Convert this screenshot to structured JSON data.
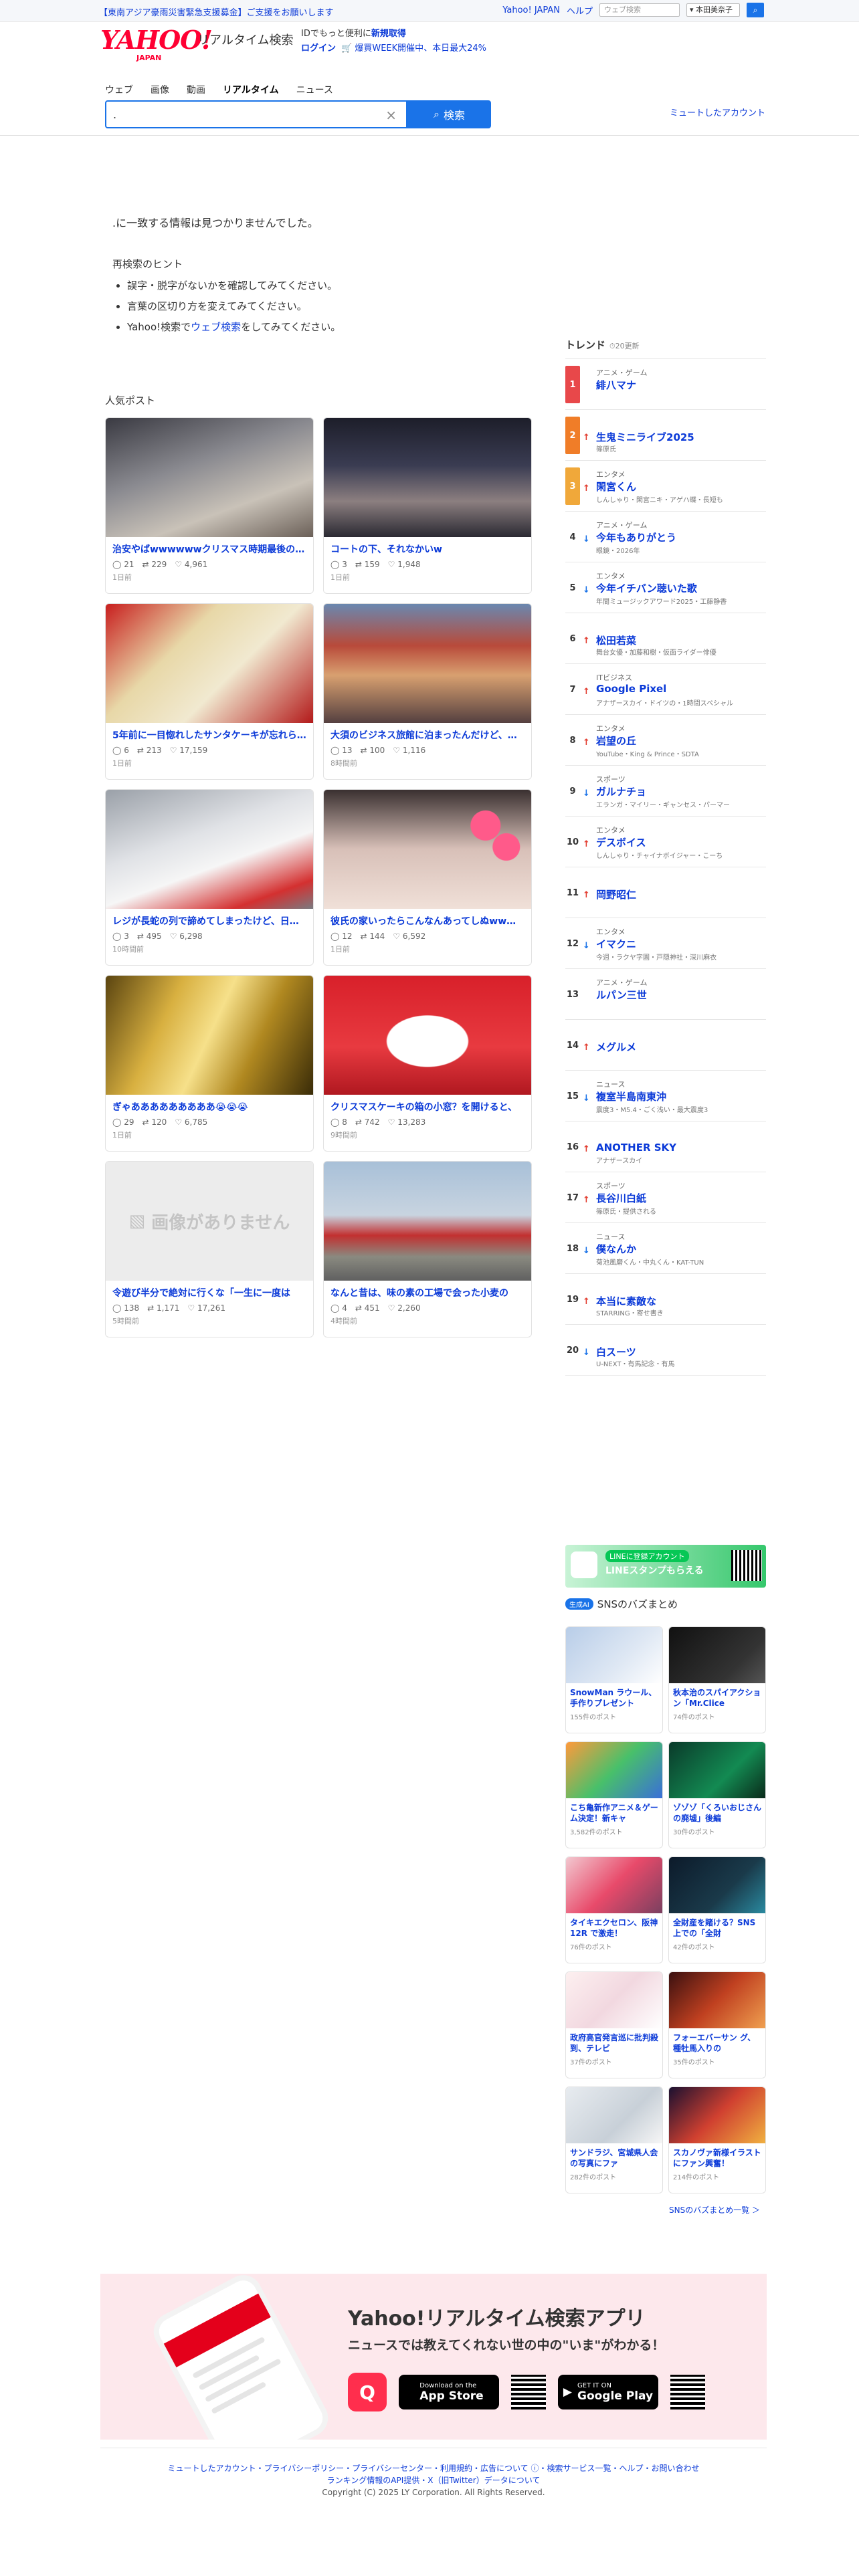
{
  "topbar": {
    "notice": "【東南アジア豪雨災害緊急支援募金】ご支援をお願いします",
    "links": [
      "Yahoo! JAPAN",
      "ヘルプ"
    ],
    "search_placeholder": "ウェブ検索",
    "search_scope": "▾ 本田美奈子"
  },
  "header": {
    "logo": "YAHOO!",
    "logo_sub": "JAPAN",
    "service": "リアルタイム検索",
    "promo_line1": "IDでもっと便利に",
    "promo_line1_link": "新規取得",
    "promo_login": "ログイン",
    "promo_offer": "🛒 爆買WEEK開催中、本日最大24%"
  },
  "tabs": [
    "ウェブ",
    "画像",
    "動画",
    "リアルタイム",
    "ニュース"
  ],
  "search": {
    "query": ".",
    "button": "検索",
    "muted_link": "ミュートしたアカウント"
  },
  "noresult": {
    "message": ".に一致する情報は見つかりませんでした。",
    "hint_title": "再検索のヒント",
    "hint1": "誤字・脱字がないかを確認してみてください。",
    "hint2": "言葉の区切り方を変えてみてください。",
    "hint3_pre": "Yahoo!検索で",
    "hint3_link": "ウェブ検索",
    "hint3_post": "をしてみてください。"
  },
  "popular": {
    "title": "人気ポスト",
    "posts": [
      {
        "caption": "治安やばwwwwwwクリスマス時期最後の土曜日",
        "replies": "21",
        "reposts": "229",
        "likes": "4,961",
        "time": "1日前"
      },
      {
        "caption": "コートの下、それなかいw",
        "replies": "3",
        "reposts": "159",
        "likes": "1,948",
        "time": "1日前"
      },
      {
        "caption": "5年前に一目惚れしたサンタケーキが忘れられない",
        "replies": "6",
        "reposts": "213",
        "likes": "17,159",
        "time": "1日前"
      },
      {
        "caption": "大須のビジネス旅館に泊まったんだけど、最高",
        "replies": "13",
        "reposts": "100",
        "likes": "1,116",
        "time": "8時間前"
      },
      {
        "caption": "レジが長蛇の列で諦めてしまったけど、日本の",
        "replies": "3",
        "reposts": "495",
        "likes": "6,298",
        "time": "10時間前"
      },
      {
        "caption": "彼氏の家いったらこんなんあってしぬwwwww",
        "replies": "12",
        "reposts": "144",
        "likes": "6,592",
        "time": "1日前"
      },
      {
        "caption": "ぎゃあああああああああ😭😭😭",
        "replies": "29",
        "reposts": "120",
        "likes": "6,785",
        "time": "1日前"
      },
      {
        "caption": "クリスマスケーキの箱の小窓？を開けると、",
        "replies": "8",
        "reposts": "742",
        "likes": "13,283",
        "time": "9時間前"
      },
      {
        "caption": "令遊び半分で絶対に行くな「一生に一度は",
        "replies": "138",
        "reposts": "1,171",
        "likes": "17,261",
        "time": "5時間前"
      },
      {
        "caption": "なんと昔は、味の素の工場で会った小麦の",
        "replies": "4",
        "reposts": "451",
        "likes": "2,260",
        "time": "4時間前"
      }
    ],
    "no_image_label": "画像がありません"
  },
  "trends": {
    "title": "トレンド",
    "updated": "⏱20更新",
    "items": [
      {
        "rank": "1",
        "dir": "",
        "cat": "アニメ・ゲーム",
        "name": "緋八マナ",
        "sub": ""
      },
      {
        "rank": "2",
        "dir": "up",
        "cat": "",
        "name": "生鬼ミニライブ2025",
        "sub": "篠原氏"
      },
      {
        "rank": "3",
        "dir": "up",
        "cat": "エンタメ",
        "name": "閑宮くん",
        "sub": "しんしゃり・閑宮ニキ・アゲハ蝶・長短も"
      },
      {
        "rank": "4",
        "dir": "down",
        "cat": "アニメ・ゲーム",
        "name": "今年もありがとう",
        "sub": "眼鏡・2026年"
      },
      {
        "rank": "5",
        "dir": "down",
        "cat": "エンタメ",
        "name": "今年イチバン聴いた歌",
        "sub": "年間ミュージックアワード2025・工藤静香"
      },
      {
        "rank": "6",
        "dir": "up",
        "cat": "",
        "name": "松田若菜",
        "sub": "舞台女優・加藤和樹・仮面ライダー俳優"
      },
      {
        "rank": "7",
        "dir": "up",
        "cat": "ITビジネス",
        "name": "Google Pixel",
        "sub": "アナザースカイ・ドイツの・1時間スペシャル"
      },
      {
        "rank": "8",
        "dir": "up",
        "cat": "エンタメ",
        "name": "岩望の丘",
        "sub": "YouTube・King & Prince・SDTA"
      },
      {
        "rank": "9",
        "dir": "down",
        "cat": "スポーツ",
        "name": "ガルナチョ",
        "sub": "エランガ・マイリー・ギャンセス・パーマー"
      },
      {
        "rank": "10",
        "dir": "up",
        "cat": "エンタメ",
        "name": "デスボイス",
        "sub": "しんしゃり・チャイナボイジャー・こーち"
      },
      {
        "rank": "11",
        "dir": "up",
        "cat": "",
        "name": "岡野昭仁",
        "sub": ""
      },
      {
        "rank": "12",
        "dir": "down",
        "cat": "エンタメ",
        "name": "イマクニ",
        "sub": "今週・ラクヤ字園・戸隠神社・深川麻衣"
      },
      {
        "rank": "13",
        "dir": "",
        "cat": "アニメ・ゲーム",
        "name": "ルパン三世",
        "sub": ""
      },
      {
        "rank": "14",
        "dir": "up",
        "cat": "",
        "name": "メグルメ",
        "sub": ""
      },
      {
        "rank": "15",
        "dir": "down",
        "cat": "ニュース",
        "name": "複室半島南東沖",
        "sub": "震度3・M5.4・ごく浅い・最大震度3"
      },
      {
        "rank": "16",
        "dir": "up",
        "cat": "",
        "name": "ANOTHER SKY",
        "sub": "アナザースカイ"
      },
      {
        "rank": "17",
        "dir": "up",
        "cat": "スポーツ",
        "name": "長谷川白紙",
        "sub": "篠原氏・提供される"
      },
      {
        "rank": "18",
        "dir": "down",
        "cat": "ニュース",
        "name": "僕なんか",
        "sub": "菊池風磨くん・中丸くん・KAT-TUN"
      },
      {
        "rank": "19",
        "dir": "up",
        "cat": "",
        "name": "本当に素敵な",
        "sub": "STARRING・寄せ書き"
      },
      {
        "rank": "20",
        "dir": "down",
        "cat": "",
        "name": "白スーツ",
        "sub": "U-NEXT・有馬記念・有馬"
      }
    ]
  },
  "line_banner": {
    "badge": "LINEに登録アカウント",
    "text": "LINEスタンプもらえる"
  },
  "sns": {
    "badge": "生成AI",
    "title": "SNSのバズまとめ",
    "more": "SNSのバズまとめ一覧 ＞",
    "items": [
      {
        "title": "SnowMan ラウール、手作りプレゼント",
        "count": "155件のポスト"
      },
      {
        "title": "秋本治のスパイアクション「Mr.Clice",
        "count": "74件のポスト"
      },
      {
        "title": "こち亀新作アニメ＆ゲーム決定！新キャ",
        "count": "3,582件のポスト"
      },
      {
        "title": "ゾゾゾ「くろいおじさんの廃墟」後編",
        "count": "30件のポスト"
      },
      {
        "title": "タイキエクセロン、阪神12R で激走！",
        "count": "76件のポスト"
      },
      {
        "title": "全財産を賭ける？SNS上での「全財",
        "count": "42件のポスト"
      },
      {
        "title": "政府高官発言巡に批判殺到、テレビ",
        "count": "37件のポスト"
      },
      {
        "title": "フォーエバーサン グ、種牡馬入りの",
        "count": "35件のポスト"
      },
      {
        "title": "サンドラジ、宮城県人会の写真にファ",
        "count": "282件のポスト"
      },
      {
        "title": "スカノヴァ新様イラストにファン興奮！",
        "count": "214件のポスト"
      }
    ]
  },
  "app_banner": {
    "title": "Yahoo!リアルタイム検索アプリ",
    "subtitle": "ニュースでは教えてくれない世の中の\"いま\"がわかる！",
    "appstore_small": "Download on the",
    "appstore": "App Store",
    "google_small": "GET IT ON",
    "google": "Google Play"
  },
  "footer": {
    "links": "ミュートしたアカウント・プライバシーポリシー・プライバシーセンター・利用規約・広告について ⓘ・検索サービス一覧・ヘルプ・お問い合わせ",
    "links2": "ランキング情報のAPI提供・X（旧Twitter）データについて",
    "copyright": "Copyright (C) 2025 LY Corporation. All Rights Reserved."
  }
}
